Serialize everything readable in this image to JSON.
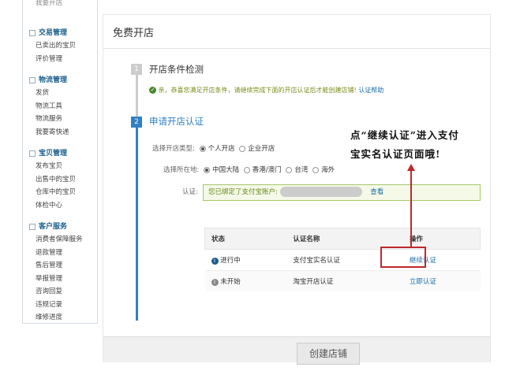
{
  "sidebar": {
    "top_partial": "我要开店",
    "groups": [
      {
        "title": "交易管理",
        "items": [
          "已卖出的宝贝",
          "评价管理"
        ]
      },
      {
        "title": "物流管理",
        "items": [
          "发货",
          "物流工具",
          "物流服务",
          "我要寄快递"
        ]
      },
      {
        "title": "宝贝管理",
        "items": [
          "发布宝贝",
          "出售中的宝贝",
          "仓库中的宝贝",
          "体检中心"
        ]
      },
      {
        "title": "客户服务",
        "items": [
          "消费者保障服务",
          "退款管理",
          "售后管理",
          "举报管理",
          "咨询回复",
          "违规记录",
          "维修进度"
        ]
      }
    ]
  },
  "main": {
    "title": "免费开店",
    "step1": {
      "num": "1",
      "title": "开店条件检测",
      "message": "亲，恭喜您满足开店条件，请继续完成下面的开店认证后才能创建店铺!",
      "help_link": "认证帮助"
    },
    "step2": {
      "num": "2",
      "title": "申请开店认证",
      "type_label": "选择开店类型:",
      "type_options": [
        "个人开店",
        "企业开店"
      ],
      "loc_label": "选择所在地:",
      "loc_options": [
        "中国大陆",
        "香港/澳门",
        "台湾",
        "海外"
      ],
      "auth_label": "认证:",
      "auth_text": "您已绑定了支付宝账户:",
      "auth_view": "查看"
    },
    "table": {
      "headers": [
        "状态",
        "认证名称",
        "操作"
      ],
      "rows": [
        {
          "status": "进行中",
          "name": "支付宝实名认证",
          "action": "继续认证"
        },
        {
          "status": "未开始",
          "name": "淘宝开店认证",
          "action": "立即认证"
        }
      ]
    },
    "create_button": "创建店铺"
  },
  "annotation": {
    "line1": "点“继续认证”进入支付",
    "line2": "宝实名认证页面哦!"
  },
  "colors": {
    "accent": "#1b6ea8",
    "annotation": "#c0282d",
    "success": "#5a9a2a"
  }
}
